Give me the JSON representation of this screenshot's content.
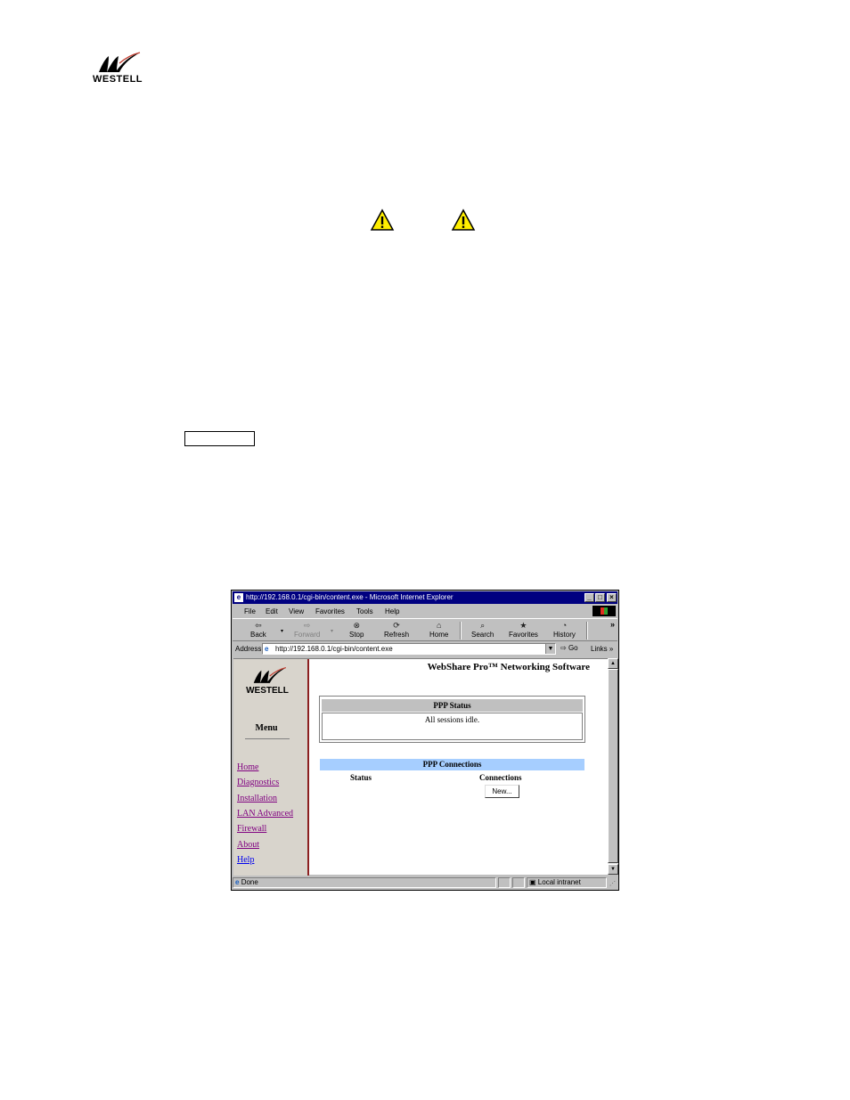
{
  "page_logo": {
    "text": "WESTELL"
  },
  "browser": {
    "title": "http://192.168.0.1/cgi-bin/content.exe - Microsoft Internet Explorer",
    "menu": [
      "File",
      "Edit",
      "View",
      "Favorites",
      "Tools",
      "Help"
    ],
    "toolbar": {
      "back": "Back",
      "forward": "Forward",
      "stop": "Stop",
      "refresh": "Refresh",
      "home": "Home",
      "search": "Search",
      "favorites": "Favorites",
      "history": "History",
      "more": "»"
    },
    "address_label": "Address",
    "address_value": "http://192.168.0.1/cgi-bin/content.exe",
    "go_label": "Go",
    "links_label": "Links »",
    "status_text": "Done",
    "zone_text": "Local intranet"
  },
  "sidebar": {
    "logo_text": "WESTELL",
    "menu_title": "Menu",
    "links": [
      "Home",
      "Diagnostics",
      "Installation",
      "LAN Advanced",
      "Firewall",
      "About",
      "Help"
    ]
  },
  "main": {
    "product_title": "WebShare Pro™ Networking Software",
    "ppp_status_header": "PPP Status",
    "ppp_status_text": "All sessions idle.",
    "ppp_connections_header": "PPP Connections",
    "col_status": "Status",
    "col_connections": "Connections",
    "new_button": "New..."
  }
}
